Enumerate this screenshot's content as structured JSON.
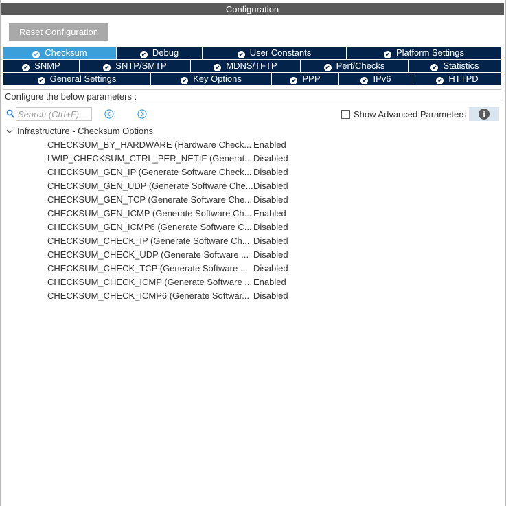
{
  "header": {
    "title": "Configuration"
  },
  "toolbar": {
    "reset_label": "Reset Configuration"
  },
  "tabs": [
    {
      "label": "Checksum",
      "active": true
    },
    {
      "label": "Debug"
    },
    {
      "label": "User Constants"
    },
    {
      "label": "Platform Settings"
    },
    {
      "label": "SNMP"
    },
    {
      "label": "SNTP/SMTP"
    },
    {
      "label": "MDNS/TFTP"
    },
    {
      "label": "Perf/Checks"
    },
    {
      "label": "Statistics"
    },
    {
      "label": "General Settings"
    },
    {
      "label": "Key Options"
    },
    {
      "label": "PPP"
    },
    {
      "label": "IPv6"
    },
    {
      "label": "HTTPD"
    }
  ],
  "hint_text": "Configure the below parameters :",
  "search": {
    "placeholder": "Search (Ctrl+F)"
  },
  "advanced": {
    "label": "Show Advanced Parameters",
    "checked": false
  },
  "group": {
    "label": "Infrastructure - Checksum Options"
  },
  "params": [
    {
      "name": "CHECKSUM_BY_HARDWARE (Hardware Check...",
      "value": "Enabled"
    },
    {
      "name": "LWIP_CHECKSUM_CTRL_PER_NETIF (Generat...",
      "value": "Disabled"
    },
    {
      "name": "CHECKSUM_GEN_IP (Generate Software Check...",
      "value": "Disabled"
    },
    {
      "name": "CHECKSUM_GEN_UDP (Generate Software Che...",
      "value": "Disabled"
    },
    {
      "name": "CHECKSUM_GEN_TCP (Generate Software Che...",
      "value": "Disabled"
    },
    {
      "name": "CHECKSUM_GEN_ICMP (Generate Software Ch...",
      "value": "Enabled"
    },
    {
      "name": "CHECKSUM_GEN_ICMP6 (Generate Software C...",
      "value": "Disabled"
    },
    {
      "name": "CHECKSUM_CHECK_IP (Generate Software Ch...",
      "value": "Disabled"
    },
    {
      "name": "CHECKSUM_CHECK_UDP (Generate Software ...",
      "value": "Disabled"
    },
    {
      "name": "CHECKSUM_CHECK_TCP (Generate Software ...",
      "value": "Disabled"
    },
    {
      "name": "CHECKSUM_CHECK_ICMP (Generate Software ...",
      "value": "Enabled"
    },
    {
      "name": "CHECKSUM_CHECK_ICMP6 (Generate Softwar...",
      "value": "Disabled"
    }
  ],
  "colors": {
    "tab_bg": "#03234b",
    "tab_active": "#3ba0da",
    "title_bar": "#5a5a5a",
    "reset_button": "#a9a9a9"
  },
  "icons": {
    "search": "search-icon",
    "prev": "arrow-left-circle-icon",
    "next": "arrow-right-circle-icon",
    "info": "info-icon",
    "expand": "chevron-down-icon",
    "tab_status": "check-circle-icon"
  }
}
